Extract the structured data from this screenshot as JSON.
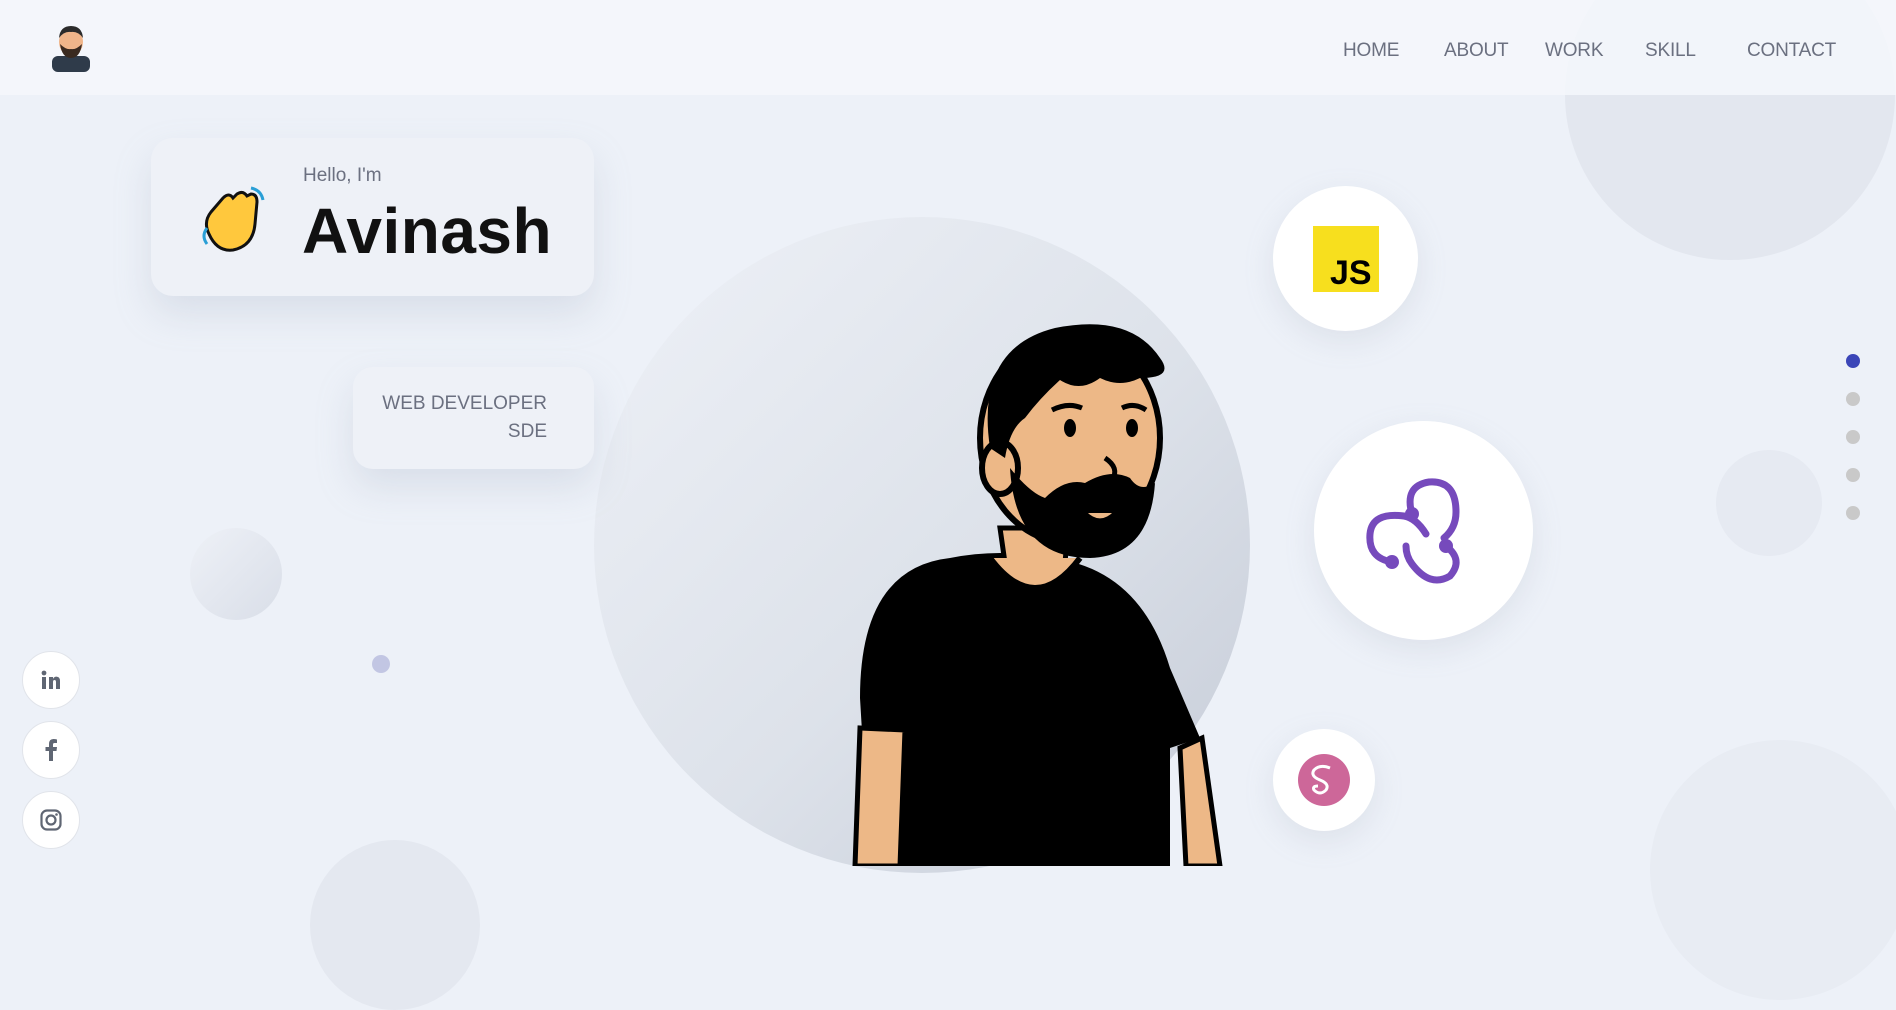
{
  "nav": {
    "items": [
      "HOME",
      "ABOUT",
      "WORK",
      "SKILL",
      "CONTACT"
    ]
  },
  "hero": {
    "greeting": "Hello, I'm",
    "name": "Avinash",
    "roles": [
      "WEB DEVELOPER",
      "SDE"
    ]
  },
  "skills": [
    "javascript-icon",
    "redux-icon",
    "sass-icon"
  ],
  "socials": [
    "linkedin-icon",
    "facebook-icon",
    "instagram-icon"
  ],
  "page_indicator": {
    "total": 5,
    "active": 1
  },
  "colors": {
    "background": "#edf1f8",
    "accent": "#3b46b8",
    "js_yellow": "#f7df1e",
    "redux_purple": "#764abc",
    "sass_pink": "#cd6799"
  }
}
